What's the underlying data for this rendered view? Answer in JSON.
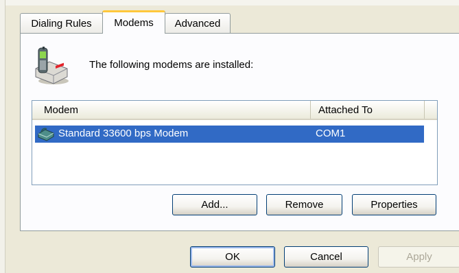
{
  "tabs": [
    {
      "label": "Dialing Rules",
      "active": false
    },
    {
      "label": "Modems",
      "active": true
    },
    {
      "label": "Advanced",
      "active": false
    }
  ],
  "intro_text": "The following modems are  installed:",
  "list": {
    "columns": [
      "Modem",
      "Attached To"
    ],
    "rows": [
      {
        "modem": "Standard 33600 bps Modem",
        "attached_to": "COM1",
        "selected": true
      }
    ]
  },
  "buttons": {
    "add": "Add...",
    "remove": "Remove",
    "properties": "Properties"
  },
  "dialog_buttons": {
    "ok": "OK",
    "cancel": "Cancel",
    "apply": "Apply"
  },
  "icons": {
    "header_icon": "phone-modem-icon",
    "row_icon": "modem-icon"
  },
  "colors": {
    "dialog_bg": "#ECE9D8",
    "tab_highlight": "#FFC83C",
    "selection": "#316AC5",
    "button_border": "#003C74"
  }
}
